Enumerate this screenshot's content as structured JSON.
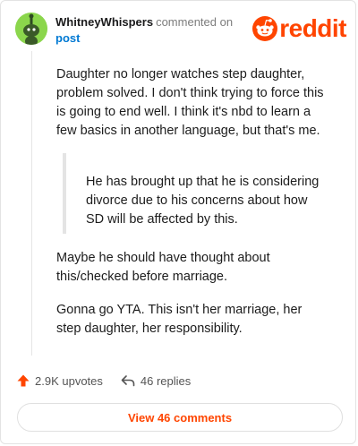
{
  "comment": {
    "username": "WhitneyWhispers",
    "action": "commented on",
    "post_link": "post",
    "paragraph_1": "Daughter no longer watches step daughter, problem solved. I don't think trying to force this is going to end well. I think it's nbd to learn a few basics in another language, but that's me.",
    "quote": "He has brought up that he is considering divorce due to his concerns about how SD will be affected by this.",
    "paragraph_2": "Maybe he should have thought about this/checked before marriage.",
    "paragraph_3": "Gonna go YTA. This isn't her marriage, her step daughter, her responsibility."
  },
  "logo": {
    "text": "reddit",
    "icon": "reddit-snoo-icon",
    "color": "#ff4500"
  },
  "stats": {
    "upvotes": "2.9K upvotes",
    "upvote_icon": "upvote-arrow-icon",
    "replies": "46 replies",
    "reply_icon": "reply-arrow-icon"
  },
  "view_button": {
    "label": "View 46 comments"
  },
  "colors": {
    "accent": "#ff4500",
    "link": "#0079d3",
    "avatar_bg": "#8bd64c"
  }
}
